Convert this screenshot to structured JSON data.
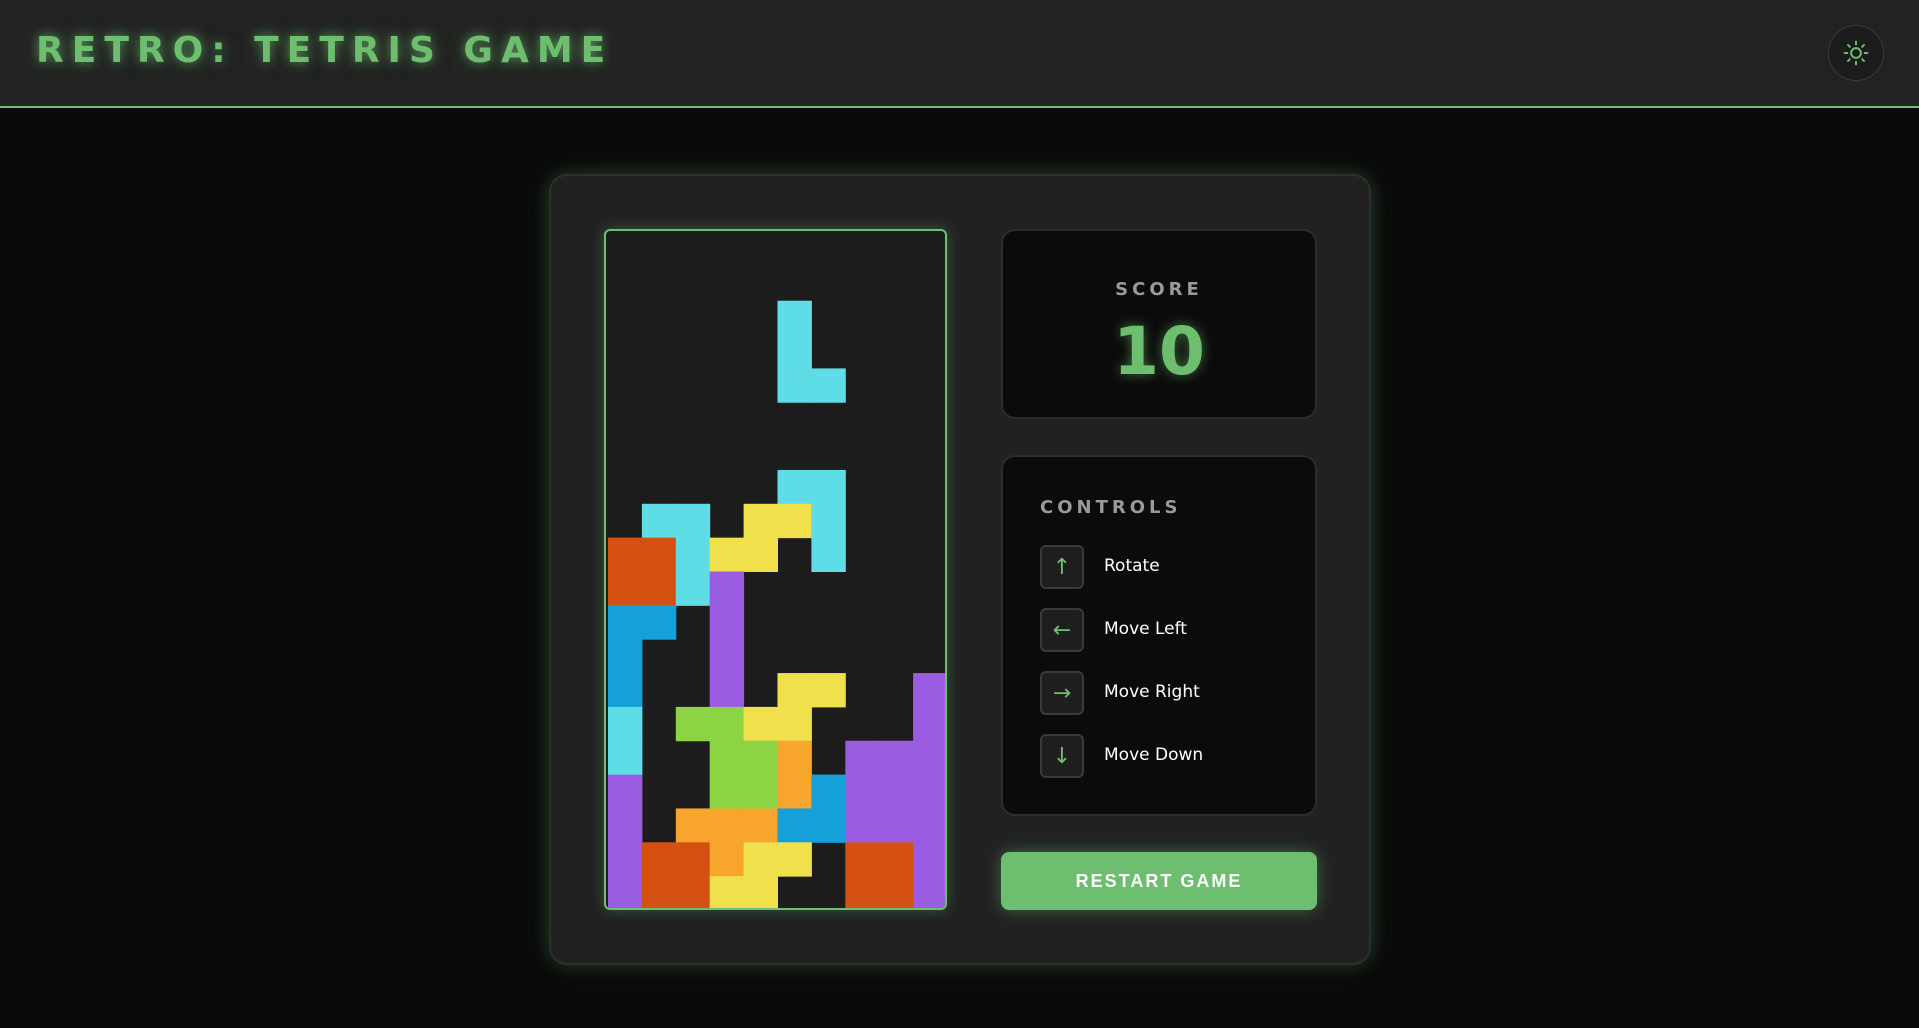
{
  "header": {
    "title": "RETRO: TETRIS GAME",
    "theme_icon": "sun-icon"
  },
  "board": {
    "columns": 10,
    "rows": 20,
    "active_piece": {
      "color": "#5fdde6",
      "cells": [
        [
          5,
          2
        ],
        [
          5,
          3
        ],
        [
          5,
          4
        ],
        [
          6,
          4
        ]
      ]
    },
    "locked_cells": [
      [
        5,
        7,
        "#5fdde6"
      ],
      [
        6,
        7,
        "#5fdde6"
      ],
      [
        1,
        8,
        "#5fdde6"
      ],
      [
        2,
        8,
        "#5fdde6"
      ],
      [
        4,
        8,
        "#f0e04c"
      ],
      [
        5,
        8,
        "#f0e04c"
      ],
      [
        6,
        8,
        "#5fdde6"
      ],
      [
        0,
        9,
        "#d55113"
      ],
      [
        1,
        9,
        "#d55113"
      ],
      [
        2,
        9,
        "#5fdde6"
      ],
      [
        3,
        9,
        "#f0e04c"
      ],
      [
        4,
        9,
        "#f0e04c"
      ],
      [
        6,
        9,
        "#5fdde6"
      ],
      [
        0,
        10,
        "#d55113"
      ],
      [
        1,
        10,
        "#d55113"
      ],
      [
        2,
        10,
        "#5fdde6"
      ],
      [
        3,
        10,
        "#9a5ce0"
      ],
      [
        0,
        11,
        "#14a1d9"
      ],
      [
        1,
        11,
        "#14a1d9"
      ],
      [
        3,
        11,
        "#9a5ce0"
      ],
      [
        0,
        12,
        "#14a1d9"
      ],
      [
        3,
        12,
        "#9a5ce0"
      ],
      [
        0,
        13,
        "#14a1d9"
      ],
      [
        3,
        13,
        "#9a5ce0"
      ],
      [
        5,
        13,
        "#f0e04c"
      ],
      [
        6,
        13,
        "#f0e04c"
      ],
      [
        9,
        13,
        "#9a5ce0"
      ],
      [
        0,
        14,
        "#5fdde6"
      ],
      [
        2,
        14,
        "#8cd443"
      ],
      [
        3,
        14,
        "#8cd443"
      ],
      [
        4,
        14,
        "#f0e04c"
      ],
      [
        5,
        14,
        "#f0e04c"
      ],
      [
        9,
        14,
        "#9a5ce0"
      ],
      [
        0,
        15,
        "#5fdde6"
      ],
      [
        3,
        15,
        "#8cd443"
      ],
      [
        4,
        15,
        "#8cd443"
      ],
      [
        5,
        15,
        "#f7a52c"
      ],
      [
        7,
        15,
        "#9a5ce0"
      ],
      [
        8,
        15,
        "#9a5ce0"
      ],
      [
        9,
        15,
        "#9a5ce0"
      ],
      [
        0,
        16,
        "#9a5ce0"
      ],
      [
        3,
        16,
        "#8cd443"
      ],
      [
        4,
        16,
        "#8cd443"
      ],
      [
        5,
        16,
        "#f7a52c"
      ],
      [
        6,
        16,
        "#14a1d9"
      ],
      [
        7,
        16,
        "#9a5ce0"
      ],
      [
        8,
        16,
        "#9a5ce0"
      ],
      [
        9,
        16,
        "#9a5ce0"
      ],
      [
        0,
        17,
        "#9a5ce0"
      ],
      [
        2,
        17,
        "#f7a52c"
      ],
      [
        3,
        17,
        "#f7a52c"
      ],
      [
        4,
        17,
        "#f7a52c"
      ],
      [
        5,
        17,
        "#14a1d9"
      ],
      [
        6,
        17,
        "#14a1d9"
      ],
      [
        7,
        17,
        "#9a5ce0"
      ],
      [
        8,
        17,
        "#9a5ce0"
      ],
      [
        9,
        17,
        "#9a5ce0"
      ],
      [
        0,
        18,
        "#9a5ce0"
      ],
      [
        1,
        18,
        "#d55113"
      ],
      [
        2,
        18,
        "#d55113"
      ],
      [
        3,
        18,
        "#f7a52c"
      ],
      [
        4,
        18,
        "#f0e04c"
      ],
      [
        5,
        18,
        "#f0e04c"
      ],
      [
        7,
        18,
        "#d55113"
      ],
      [
        8,
        18,
        "#d55113"
      ],
      [
        9,
        18,
        "#9a5ce0"
      ],
      [
        0,
        19,
        "#9a5ce0"
      ],
      [
        1,
        19,
        "#d55113"
      ],
      [
        2,
        19,
        "#d55113"
      ],
      [
        3,
        19,
        "#f0e04c"
      ],
      [
        4,
        19,
        "#f0e04c"
      ],
      [
        7,
        19,
        "#d55113"
      ],
      [
        8,
        19,
        "#d55113"
      ],
      [
        9,
        19,
        "#9a5ce0"
      ]
    ]
  },
  "score": {
    "label": "SCORE",
    "value": "10"
  },
  "controls": {
    "title": "CONTROLS",
    "items": [
      {
        "key": "↑",
        "label": "Rotate",
        "icon": "arrow-up-icon"
      },
      {
        "key": "←",
        "label": "Move Left",
        "icon": "arrow-left-icon"
      },
      {
        "key": "→",
        "label": "Move Right",
        "icon": "arrow-right-icon"
      },
      {
        "key": "↓",
        "label": "Move Down",
        "icon": "arrow-down-icon"
      }
    ]
  },
  "restart": {
    "label": "RESTART GAME"
  },
  "colors": {
    "accent": "#6dbf6f",
    "board_bg": "#1c1c1c"
  }
}
